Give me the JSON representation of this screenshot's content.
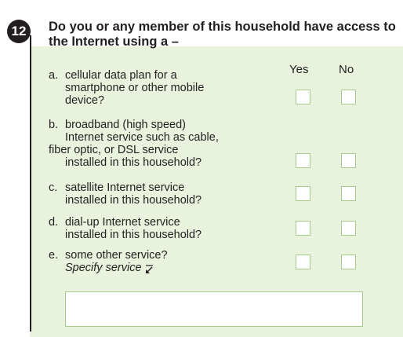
{
  "question": {
    "number": "12",
    "text": "Do you or any member of this household have access to the Internet using a –"
  },
  "columns": {
    "yes": "Yes",
    "no": "No"
  },
  "items": [
    {
      "letter": "a.",
      "lines": [
        "cellular data plan for a",
        "smartphone or other mobile",
        "device?"
      ]
    },
    {
      "letter": "b.",
      "lines": [
        "broadband (high speed)",
        "Internet service such as cable,",
        "fiber optic, or DSL service",
        "installed in this household?"
      ]
    },
    {
      "letter": "c.",
      "lines": [
        "satellite Internet service",
        "installed in this household?"
      ]
    },
    {
      "letter": "d.",
      "lines": [
        "dial-up Internet service",
        "installed in this household?"
      ]
    },
    {
      "letter": "e.",
      "lines": [
        "some other service?"
      ],
      "specify": "Specify service"
    }
  ],
  "specify_field": {
    "value": "",
    "placeholder": ""
  },
  "colors": {
    "panel": "#e9f2dc",
    "checkbox_border": "#a7c98b",
    "ink": "#231f20"
  }
}
